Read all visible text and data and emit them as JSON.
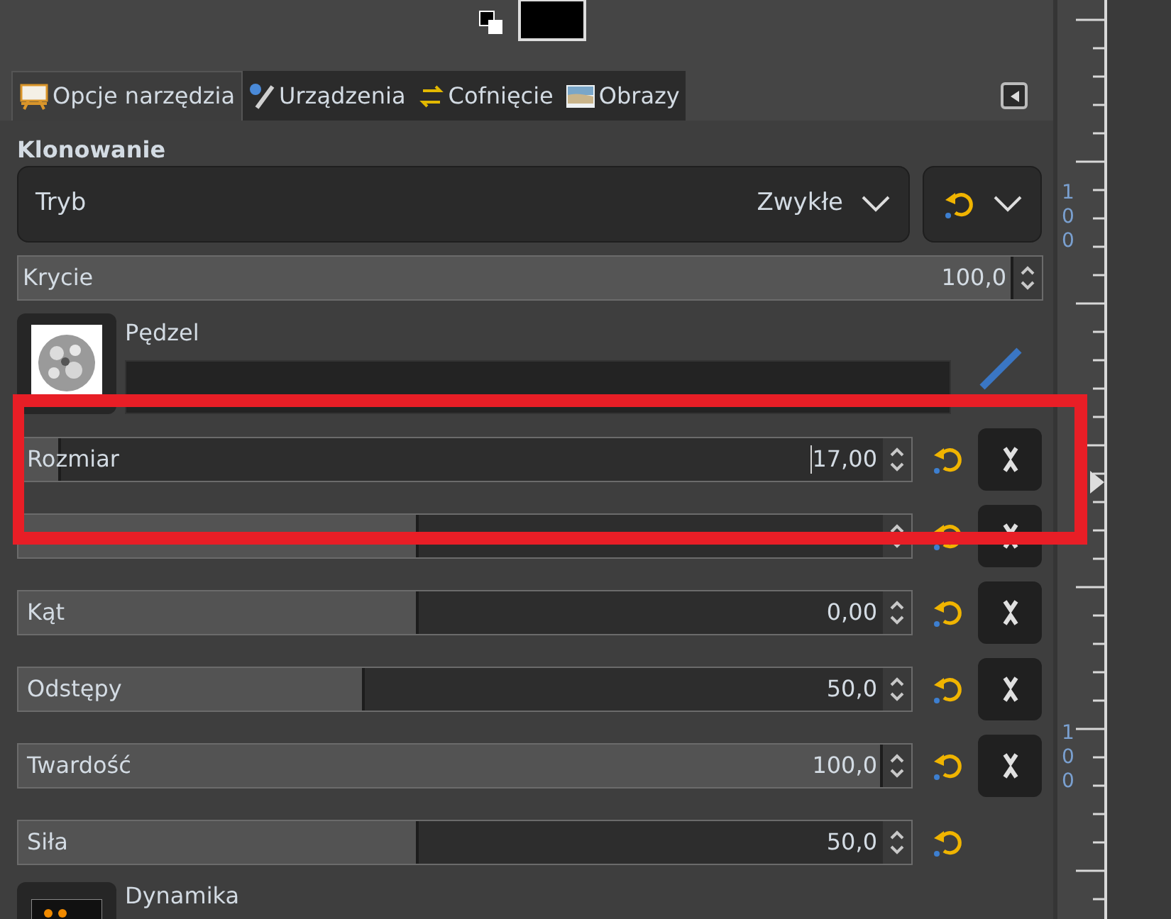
{
  "tabs": [
    {
      "label": "Opcje narzędzia",
      "selected": true
    },
    {
      "label": "Urządzenia",
      "selected": false
    },
    {
      "label": "Cofnięcie",
      "selected": false
    },
    {
      "label": "Obrazy",
      "selected": false
    }
  ],
  "tool_title": "Klonowanie",
  "mode": {
    "label": "Tryb",
    "value": "Zwykłe"
  },
  "opacity": {
    "label": "Krycie",
    "value": "100,0",
    "level": 1
  },
  "brush": {
    "label": "Pędzel"
  },
  "sliders": [
    {
      "label": "Rozmiar",
      "value": "17,00",
      "level": 0.08,
      "focused": true,
      "link_button": true
    },
    {
      "level": 0.48,
      "link_button": true
    },
    {
      "label": "Kąt",
      "value": "0,00",
      "level": 0.48,
      "link_button": true
    },
    {
      "label": "Odstępy",
      "value": "50,0",
      "level": 0.42,
      "link_button": true
    },
    {
      "label": "Twardość",
      "value": "100,0",
      "level": 1,
      "link_button": true
    },
    {
      "label": "Siła",
      "value": "50,0",
      "level": 0.48
    }
  ],
  "dynamics": {
    "label": "Dynamika"
  },
  "ruler_labels": [
    "100",
    "100"
  ]
}
